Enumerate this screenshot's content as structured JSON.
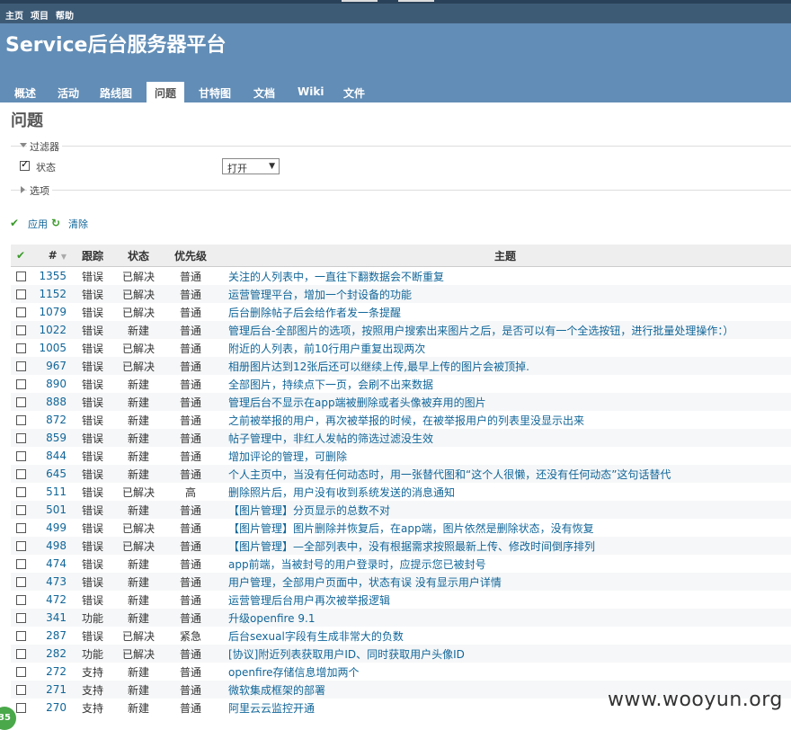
{
  "top_menu": {
    "items": [
      "主页",
      "项目",
      "帮助"
    ]
  },
  "header": {
    "title": "Service后台服务器平台"
  },
  "tabs": [
    "概述",
    "活动",
    "路线图",
    "问题",
    "甘特图",
    "文档",
    "Wiki",
    "文件"
  ],
  "selected_tab": "问题",
  "page_title": "问题",
  "filters": {
    "legend": "过滤器",
    "status_label": "状态",
    "status_checked": true,
    "status_value": "打开",
    "options_legend": "选项"
  },
  "actions": {
    "apply": "应用",
    "clear": "清除"
  },
  "table": {
    "headers": {
      "id": "#",
      "tracker": "跟踪",
      "status": "状态",
      "priority": "优先级",
      "subject": "主题"
    },
    "rows": [
      {
        "id": "1355",
        "tracker": "错误",
        "status": "已解决",
        "priority": "普通",
        "subject": "关注的人列表中，一直往下翻数据会不断重复"
      },
      {
        "id": "1152",
        "tracker": "错误",
        "status": "已解决",
        "priority": "普通",
        "subject": "运营管理平台，增加一个封设备的功能"
      },
      {
        "id": "1079",
        "tracker": "错误",
        "status": "已解决",
        "priority": "普通",
        "subject": "后台删除帖子后会给作者发一条提醒"
      },
      {
        "id": "1022",
        "tracker": "错误",
        "status": "新建",
        "priority": "普通",
        "subject": "管理后台-全部图片的选项，按照用户搜索出来图片之后，是否可以有一个全选按钮，进行批量处理操作：）"
      },
      {
        "id": "1005",
        "tracker": "错误",
        "status": "已解决",
        "priority": "普通",
        "subject": "附近的人列表，前10行用户重复出现两次"
      },
      {
        "id": "967",
        "tracker": "错误",
        "status": "已解决",
        "priority": "普通",
        "subject": "相册图片达到12张后还可以继续上传,最早上传的图片会被顶掉."
      },
      {
        "id": "890",
        "tracker": "错误",
        "status": "新建",
        "priority": "普通",
        "subject": "全部图片，持续点下一页，会刷不出来数据"
      },
      {
        "id": "888",
        "tracker": "错误",
        "status": "新建",
        "priority": "普通",
        "subject": "管理后台不显示在app端被删除或者头像被弃用的图片"
      },
      {
        "id": "872",
        "tracker": "错误",
        "status": "新建",
        "priority": "普通",
        "subject": "之前被举报的用户，再次被举报的时候，在被举报用户的列表里没显示出来"
      },
      {
        "id": "859",
        "tracker": "错误",
        "status": "新建",
        "priority": "普通",
        "subject": "帖子管理中，非红人发帖的筛选过滤没生效"
      },
      {
        "id": "844",
        "tracker": "错误",
        "status": "新建",
        "priority": "普通",
        "subject": "增加评论的管理，可删除"
      },
      {
        "id": "645",
        "tracker": "错误",
        "status": "新建",
        "priority": "普通",
        "subject": "个人主页中，当没有任何动态时，用一张替代图和“这个人很懒，还没有任何动态”这句话替代"
      },
      {
        "id": "511",
        "tracker": "错误",
        "status": "已解决",
        "priority": "高",
        "subject": "删除照片后，用户没有收到系统发送的消息通知"
      },
      {
        "id": "501",
        "tracker": "错误",
        "status": "新建",
        "priority": "普通",
        "subject": "【图片管理】分页显示的总数不对"
      },
      {
        "id": "499",
        "tracker": "错误",
        "status": "已解决",
        "priority": "普通",
        "subject": "【图片管理】图片删除并恢复后，在app端，图片依然是删除状态，没有恢复"
      },
      {
        "id": "498",
        "tracker": "错误",
        "status": "已解决",
        "priority": "普通",
        "subject": "【图片管理】—全部列表中，没有根据需求按照最新上传、修改时间倒序排列"
      },
      {
        "id": "474",
        "tracker": "错误",
        "status": "新建",
        "priority": "普通",
        "subject": "app前端，当被封号的用户登录时，应提示您已被封号"
      },
      {
        "id": "473",
        "tracker": "错误",
        "status": "新建",
        "priority": "普通",
        "subject": "用户管理，全部用户页面中，状态有误 没有显示用户详情"
      },
      {
        "id": "472",
        "tracker": "错误",
        "status": "新建",
        "priority": "普通",
        "subject": "运营管理后台用户再次被举报逻辑"
      },
      {
        "id": "341",
        "tracker": "功能",
        "status": "新建",
        "priority": "普通",
        "subject": "升级openfire 9.1"
      },
      {
        "id": "287",
        "tracker": "错误",
        "status": "已解决",
        "priority": "紧急",
        "subject": "后台sexual字段有生成非常大的负数"
      },
      {
        "id": "282",
        "tracker": "功能",
        "status": "已解决",
        "priority": "普通",
        "subject": "[协议]附近列表获取用户ID、同时获取用户头像ID"
      },
      {
        "id": "272",
        "tracker": "支持",
        "status": "新建",
        "priority": "普通",
        "subject": "openfire存储信息增加两个"
      },
      {
        "id": "271",
        "tracker": "支持",
        "status": "新建",
        "priority": "普通",
        "subject": "微软集成框架的部署"
      },
      {
        "id": "270",
        "tracker": "支持",
        "status": "新建",
        "priority": "普通",
        "subject": "阿里云云监控开通"
      }
    ]
  },
  "watermark": "www.wooyun.org",
  "badge": "35"
}
